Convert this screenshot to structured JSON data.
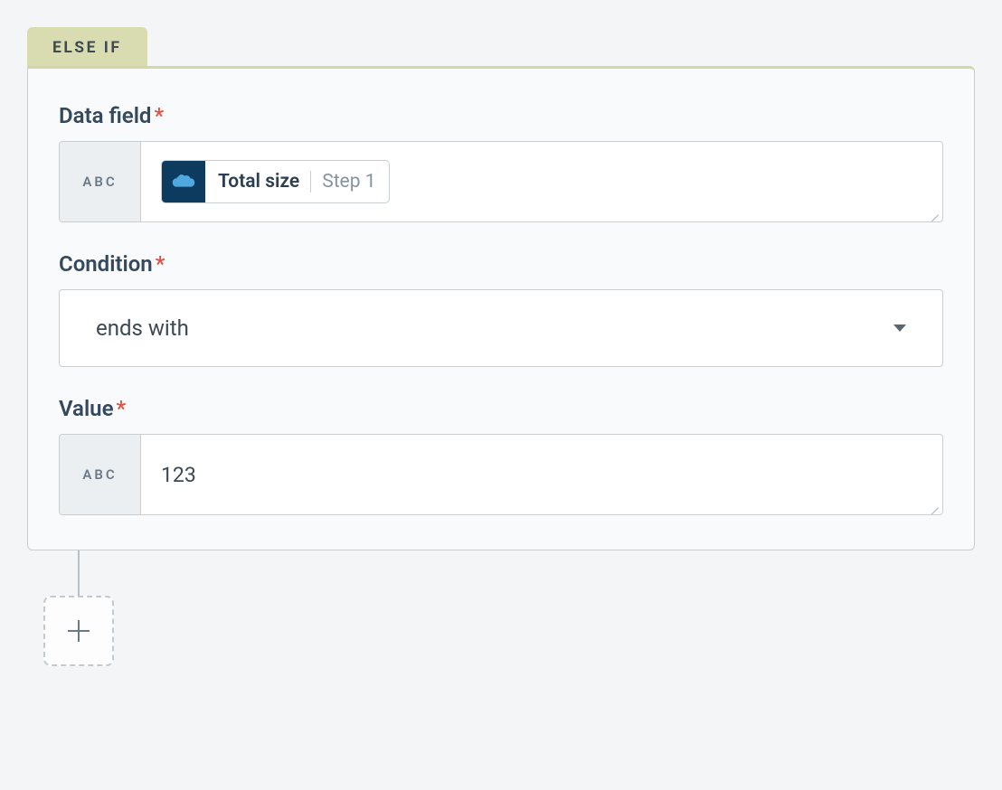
{
  "tab": {
    "label": "ELSE IF"
  },
  "fields": {
    "data_field": {
      "label": "Data field",
      "prefix": "ABC",
      "pill": {
        "main": "Total size",
        "sub": "Step 1",
        "icon": "salesforce"
      }
    },
    "condition": {
      "label": "Condition",
      "selected": "ends with"
    },
    "value": {
      "label": "Value",
      "prefix": "ABC",
      "text": "123"
    }
  },
  "required_marker": "*"
}
